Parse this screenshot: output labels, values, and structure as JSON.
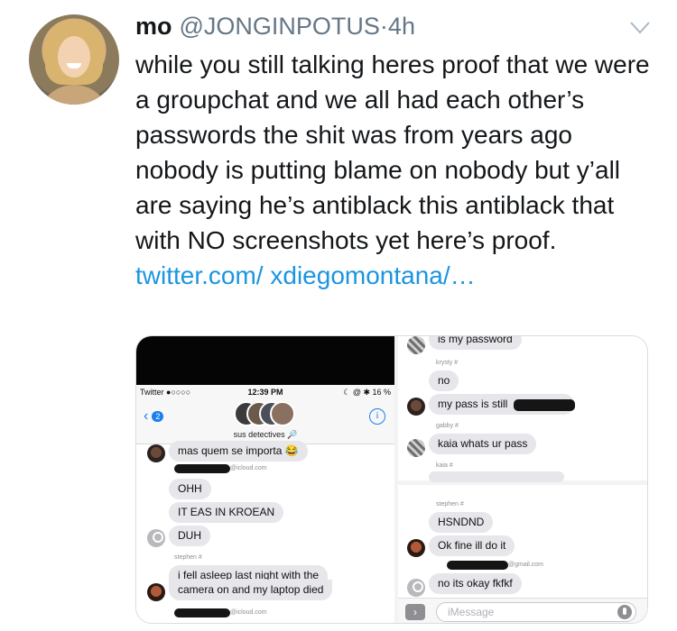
{
  "tweet": {
    "display_name": "mo",
    "handle": "@JONGINPOTUS",
    "separator": "·",
    "time": "4h",
    "text": "while you still talking heres proof that we were a groupchat and we all had each other’s passwords the shit was from years ago nobody is putting blame on nobody but y’all are saying he’s antiblack this antiblack that with NO screenshots yet here’s proof.",
    "link_line1": "twitter.com/",
    "link_line2": "xdiegomontana/…"
  },
  "icons": {
    "more": "chevron-down-icon",
    "avatar": "profile-photo"
  },
  "colors": {
    "link": "#1b95e0",
    "handle": "#657786",
    "ios_blue": "#1a7ff0",
    "bubble": "#e6e6eb"
  },
  "left_screenshot": {
    "status_left": "Twitter ●○○○○ ",
    "status_time": "12:39 PM",
    "status_right": "☾ @ ✱ 16 %",
    "back_count": "2",
    "group_name": "sus detectives 🔎",
    "info_symbol": "i",
    "messages": [
      {
        "text": "mas quem se importa 😂"
      },
      {
        "sender": "@icloud.com"
      },
      {
        "text": "OHH"
      },
      {
        "text": "IT EAS IN KROEAN"
      },
      {
        "text": "DUH"
      },
      {
        "sender": "stephen #"
      },
      {
        "text": "i fell asleep last night with the"
      },
      {
        "text": "camera on and my laptop died"
      },
      {
        "sender": "@icloud.com"
      }
    ]
  },
  "right_screenshot": {
    "top_messages": [
      {
        "text": "is my password"
      },
      {
        "sender": "krysty #"
      },
      {
        "text": "no"
      },
      {
        "text": "my pass is still"
      },
      {
        "sender": "gabby #"
      },
      {
        "text": "kaia whats ur pass"
      },
      {
        "sender": "kaia #"
      }
    ],
    "bottom_messages": [
      {
        "sender": "stephen #"
      },
      {
        "text": "HSNDND"
      },
      {
        "text": "Ok fine ill do it"
      },
      {
        "sender": "@gmail.com"
      },
      {
        "text": "no its okay fkfkf"
      }
    ],
    "input_placeholder": "iMessage"
  }
}
